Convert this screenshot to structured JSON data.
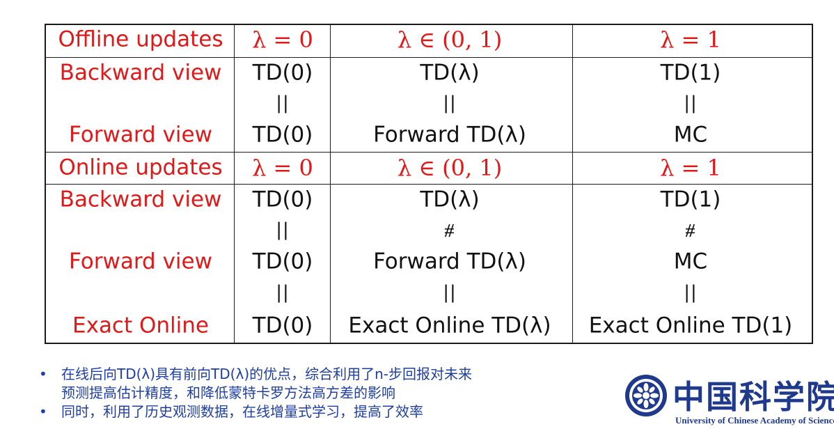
{
  "table": {
    "rows": [
      {
        "label": "Offline updates",
        "c1": "λ = 0",
        "c2": "λ ∈ (0, 1)",
        "c3": "λ = 1",
        "kind": "header"
      },
      {
        "label": "Backward view",
        "c1": "TD(0)",
        "c2": "TD(λ)",
        "c3": "TD(1)",
        "kind": "body"
      },
      {
        "label": "",
        "c1": "||",
        "c2": "||",
        "c3": "||",
        "kind": "eq"
      },
      {
        "label": "Forward view",
        "c1": "TD(0)",
        "c2": "Forward TD(λ)",
        "c3": "MC",
        "kind": "body"
      },
      {
        "label": "Online updates",
        "c1": "λ = 0",
        "c2": "λ ∈ (0, 1)",
        "c3": "λ = 1",
        "kind": "header"
      },
      {
        "label": "Backward view",
        "c1": "TD(0)",
        "c2": "TD(λ)",
        "c3": "TD(1)",
        "kind": "body"
      },
      {
        "label": "",
        "c1": "||",
        "c2": "⧣",
        "c3": "⧣",
        "kind": "eq"
      },
      {
        "label": "Forward view",
        "c1": "TD(0)",
        "c2": "Forward TD(λ)",
        "c3": "MC",
        "kind": "body"
      },
      {
        "label": "",
        "c1": "||",
        "c2": "||",
        "c3": "||",
        "kind": "eq"
      },
      {
        "label": "Exact Online",
        "c1": "TD(0)",
        "c2": "Exact Online TD(λ)",
        "c3": "Exact Online TD(1)",
        "kind": "body"
      }
    ]
  },
  "bullets": [
    {
      "line1": "在线后向TD(λ)具有前向TD(λ)的优点，综合利用了n-步回报对未来",
      "line2": "预测提高估计精度，和降低蒙特卡罗方法高方差的影响"
    },
    {
      "line1": "同时，利用了历史观测数据，在线增量式学习，提高了效率",
      "line2": ""
    }
  ],
  "logo": {
    "cn_text": "中国科学院大学",
    "en_text": "University of Chinese Academy of Sciences"
  },
  "colors": {
    "header_red": "#e01818",
    "bullet_blue": "#1f3ea3",
    "logo_blue": "#1f3a8c"
  }
}
